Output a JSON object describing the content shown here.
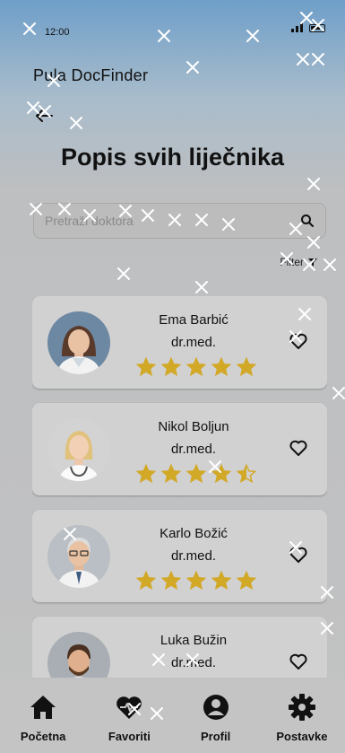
{
  "status_bar": {
    "time": "12:00"
  },
  "app": {
    "title": "Pula DocFinder"
  },
  "page": {
    "title": "Popis svih liječnika"
  },
  "search": {
    "placeholder": "Pretraži doktora"
  },
  "filter": {
    "label": "Filter"
  },
  "colors": {
    "star": "#d2a827",
    "card": "#d1d1d1",
    "background": "#c2c2c2"
  },
  "doctors": [
    {
      "name": "Ema Barbić",
      "title": "dr.med.",
      "rating": 5,
      "favorite_state": "outline"
    },
    {
      "name": "Nikol Boljun",
      "title": "dr.med.",
      "rating": 4.5,
      "favorite_state": "outline"
    },
    {
      "name": "Karlo Božić",
      "title": "dr.med.",
      "rating": 5,
      "favorite_state": "outline"
    },
    {
      "name": "Luka Bužin",
      "title": "dr.med.",
      "rating": null,
      "favorite_state": "outline"
    }
  ],
  "bottom_nav": [
    {
      "label": "Početna",
      "icon": "home-icon"
    },
    {
      "label": "Favoriti",
      "icon": "heart-icon"
    },
    {
      "label": "Profil",
      "icon": "user-circle-icon"
    },
    {
      "label": "Postavke",
      "icon": "gear-icon"
    }
  ]
}
